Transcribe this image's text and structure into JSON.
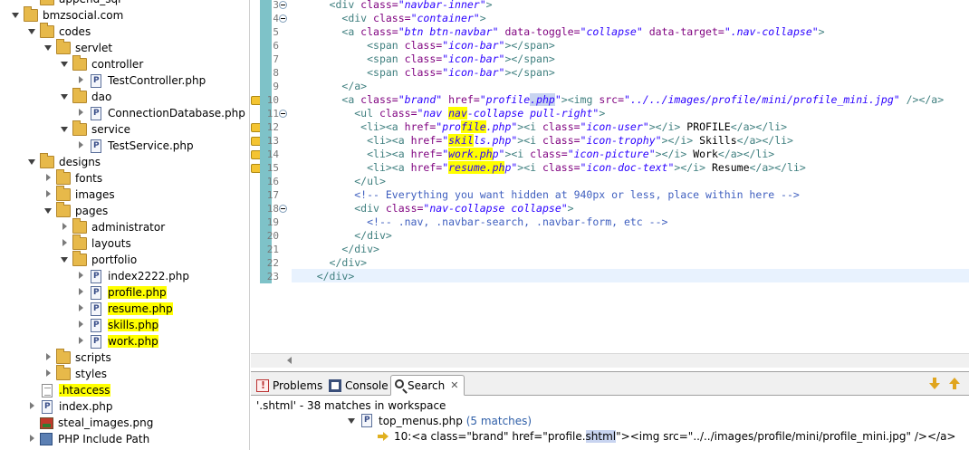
{
  "project_tree": {
    "items": [
      {
        "label": "append_sql",
        "level": 2,
        "icon": "folder-icon",
        "twisty": "none",
        "highlight": false
      },
      {
        "label": "bmzsocial.com",
        "level": 1,
        "icon": "folder-icon",
        "twisty": "open",
        "highlight": false
      },
      {
        "label": "codes",
        "level": 2,
        "icon": "folder-icon",
        "twisty": "open",
        "highlight": false
      },
      {
        "label": "servlet",
        "level": 3,
        "icon": "folder-icon",
        "twisty": "open",
        "highlight": false
      },
      {
        "label": "controller",
        "level": 4,
        "icon": "folder-icon",
        "twisty": "open",
        "highlight": false
      },
      {
        "label": "TestController.php",
        "level": 5,
        "icon": "php-file-icon",
        "twisty": "closed",
        "highlight": false
      },
      {
        "label": "dao",
        "level": 4,
        "icon": "folder-icon",
        "twisty": "open",
        "highlight": false
      },
      {
        "label": "ConnectionDatabase.php",
        "level": 5,
        "icon": "php-file-icon",
        "twisty": "closed",
        "highlight": false
      },
      {
        "label": "service",
        "level": 4,
        "icon": "folder-icon",
        "twisty": "open",
        "highlight": false
      },
      {
        "label": "TestService.php",
        "level": 5,
        "icon": "php-file-icon",
        "twisty": "closed",
        "highlight": false
      },
      {
        "label": "designs",
        "level": 2,
        "icon": "folder-icon",
        "twisty": "open",
        "highlight": false
      },
      {
        "label": "fonts",
        "level": 3,
        "icon": "folder-icon",
        "twisty": "closed",
        "highlight": false
      },
      {
        "label": "images",
        "level": 3,
        "icon": "folder-icon",
        "twisty": "closed",
        "highlight": false
      },
      {
        "label": "pages",
        "level": 3,
        "icon": "folder-icon",
        "twisty": "open",
        "highlight": false
      },
      {
        "label": "administrator",
        "level": 4,
        "icon": "folder-icon",
        "twisty": "closed",
        "highlight": false
      },
      {
        "label": "layouts",
        "level": 4,
        "icon": "folder-icon",
        "twisty": "closed",
        "highlight": false
      },
      {
        "label": "portfolio",
        "level": 4,
        "icon": "folder-icon",
        "twisty": "open",
        "highlight": false
      },
      {
        "label": "index2222.php",
        "level": 5,
        "icon": "php-file-icon",
        "twisty": "closed",
        "highlight": false
      },
      {
        "label": "profile.php",
        "level": 5,
        "icon": "php-file-icon",
        "twisty": "closed",
        "highlight": true
      },
      {
        "label": "resume.php",
        "level": 5,
        "icon": "php-file-icon",
        "twisty": "closed",
        "highlight": true
      },
      {
        "label": "skills.php",
        "level": 5,
        "icon": "php-file-icon",
        "twisty": "closed",
        "highlight": true
      },
      {
        "label": "work.php",
        "level": 5,
        "icon": "php-file-icon",
        "twisty": "closed",
        "highlight": true
      },
      {
        "label": "scripts",
        "level": 3,
        "icon": "folder-icon",
        "twisty": "closed",
        "highlight": false
      },
      {
        "label": "styles",
        "level": 3,
        "icon": "folder-icon",
        "twisty": "closed",
        "highlight": false
      },
      {
        "label": ".htaccess",
        "level": 2,
        "icon": "text-file-icon",
        "twisty": "none",
        "highlight": true
      },
      {
        "label": "index.php",
        "level": 2,
        "icon": "php-file-icon",
        "twisty": "closed",
        "highlight": false
      },
      {
        "label": "steal_images.png",
        "level": 2,
        "icon": "image-file-icon",
        "twisty": "none",
        "highlight": false
      },
      {
        "label": "PHP Include Path",
        "level": 2,
        "icon": "include-path-icon",
        "twisty": "closed",
        "highlight": false
      }
    ]
  },
  "editor": {
    "lines": [
      {
        "n": "3",
        "fold": true,
        "marker": false
      },
      {
        "n": "4",
        "fold": true,
        "marker": false
      },
      {
        "n": "5",
        "fold": false,
        "marker": false
      },
      {
        "n": "6",
        "fold": false,
        "marker": false
      },
      {
        "n": "7",
        "fold": false,
        "marker": false
      },
      {
        "n": "8",
        "fold": false,
        "marker": false
      },
      {
        "n": "9",
        "fold": false,
        "marker": false
      },
      {
        "n": "10",
        "fold": false,
        "marker": true
      },
      {
        "n": "11",
        "fold": true,
        "marker": false
      },
      {
        "n": "12",
        "fold": false,
        "marker": true
      },
      {
        "n": "13",
        "fold": false,
        "marker": true
      },
      {
        "n": "14",
        "fold": false,
        "marker": true
      },
      {
        "n": "15",
        "fold": false,
        "marker": true
      },
      {
        "n": "16",
        "fold": false,
        "marker": false
      },
      {
        "n": "17",
        "fold": false,
        "marker": false
      },
      {
        "n": "18",
        "fold": true,
        "marker": false
      },
      {
        "n": "19",
        "fold": false,
        "marker": false
      },
      {
        "n": "20",
        "fold": false,
        "marker": false
      },
      {
        "n": "21",
        "fold": false,
        "marker": false
      },
      {
        "n": "22",
        "fold": false,
        "marker": false
      },
      {
        "n": "23",
        "fold": false,
        "marker": false
      }
    ],
    "code": [
      [
        {
          "c": "tx",
          "t": "      "
        },
        {
          "c": "tg",
          "t": "<div "
        },
        {
          "c": "at",
          "t": "class="
        },
        {
          "c": "vl",
          "t": "\"navbar-inner\""
        },
        {
          "c": "tg",
          "t": ">"
        }
      ],
      [
        {
          "c": "tx",
          "t": "        "
        },
        {
          "c": "tg",
          "t": "<div "
        },
        {
          "c": "at",
          "t": "class="
        },
        {
          "c": "vl",
          "t": "\"container\""
        },
        {
          "c": "tg",
          "t": ">"
        }
      ],
      [
        {
          "c": "tx",
          "t": "        "
        },
        {
          "c": "tg",
          "t": "<a "
        },
        {
          "c": "at",
          "t": "class="
        },
        {
          "c": "vl",
          "t": "\"btn btn-navbar\""
        },
        {
          "c": "tx",
          "t": " "
        },
        {
          "c": "at",
          "t": "data-toggle="
        },
        {
          "c": "vl",
          "t": "\"collapse\""
        },
        {
          "c": "tx",
          "t": " "
        },
        {
          "c": "at",
          "t": "data-target="
        },
        {
          "c": "vl",
          "t": "\".nav-collapse\""
        },
        {
          "c": "tg",
          "t": ">"
        }
      ],
      [
        {
          "c": "tx",
          "t": "            "
        },
        {
          "c": "tg",
          "t": "<span "
        },
        {
          "c": "at",
          "t": "class="
        },
        {
          "c": "vl",
          "t": "\"icon-bar\""
        },
        {
          "c": "tg",
          "t": "></span>"
        }
      ],
      [
        {
          "c": "tx",
          "t": "            "
        },
        {
          "c": "tg",
          "t": "<span "
        },
        {
          "c": "at",
          "t": "class="
        },
        {
          "c": "vl",
          "t": "\"icon-bar\""
        },
        {
          "c": "tg",
          "t": "></span>"
        }
      ],
      [
        {
          "c": "tx",
          "t": "            "
        },
        {
          "c": "tg",
          "t": "<span "
        },
        {
          "c": "at",
          "t": "class="
        },
        {
          "c": "vl",
          "t": "\"icon-bar\""
        },
        {
          "c": "tg",
          "t": "></span>"
        }
      ],
      [
        {
          "c": "tx",
          "t": "        "
        },
        {
          "c": "tg",
          "t": "</a>"
        }
      ],
      [
        {
          "c": "tx",
          "t": "        "
        },
        {
          "c": "tg",
          "t": "<a "
        },
        {
          "c": "at",
          "t": "class="
        },
        {
          "c": "vl",
          "t": "\"brand\""
        },
        {
          "c": "tx",
          "t": " "
        },
        {
          "c": "at",
          "t": "href="
        },
        {
          "c": "vl",
          "t": "\"profile"
        },
        {
          "c": "vl sel",
          "t": ".php"
        },
        {
          "c": "vl",
          "t": "\""
        },
        {
          "c": "tg",
          "t": "><img "
        },
        {
          "c": "at",
          "t": "src="
        },
        {
          "c": "vl",
          "t": "\"../../images/profile/mini/profile_mini.jpg\""
        },
        {
          "c": "tx",
          "t": " "
        },
        {
          "c": "tg",
          "t": "/></a>"
        }
      ],
      [
        {
          "c": "tx",
          "t": "          "
        },
        {
          "c": "tg",
          "t": "<ul "
        },
        {
          "c": "at",
          "t": "class="
        },
        {
          "c": "vl",
          "t": "\"nav "
        },
        {
          "c": "vl yl",
          "t": "nav"
        },
        {
          "c": "vl",
          "t": "-collapse pull-right\""
        },
        {
          "c": "tg",
          "t": ">"
        }
      ],
      [
        {
          "c": "tx",
          "t": "           "
        },
        {
          "c": "tg",
          "t": "<li><a "
        },
        {
          "c": "at",
          "t": "href="
        },
        {
          "c": "vl",
          "t": "\"pro"
        },
        {
          "c": "vl yl",
          "t": "file"
        },
        {
          "c": "vl",
          "t": ".php\""
        },
        {
          "c": "tg",
          "t": "><i "
        },
        {
          "c": "at",
          "t": "class="
        },
        {
          "c": "vl",
          "t": "\"icon-user\""
        },
        {
          "c": "tg",
          "t": "></i>"
        },
        {
          "c": "tx",
          "t": " PROFILE"
        },
        {
          "c": "tg",
          "t": "</a></li>"
        }
      ],
      [
        {
          "c": "tx",
          "t": "            "
        },
        {
          "c": "tg",
          "t": "<li><a "
        },
        {
          "c": "at",
          "t": "href="
        },
        {
          "c": "vl",
          "t": "\""
        },
        {
          "c": "vl yl",
          "t": "skil"
        },
        {
          "c": "vl",
          "t": "ls.php\""
        },
        {
          "c": "tg",
          "t": "><i "
        },
        {
          "c": "at",
          "t": "class="
        },
        {
          "c": "vl",
          "t": "\"icon-trophy\""
        },
        {
          "c": "tg",
          "t": "></i>"
        },
        {
          "c": "tx",
          "t": " Skills"
        },
        {
          "c": "tg",
          "t": "</a></li>"
        }
      ],
      [
        {
          "c": "tx",
          "t": "            "
        },
        {
          "c": "tg",
          "t": "<li><a "
        },
        {
          "c": "at",
          "t": "href="
        },
        {
          "c": "vl",
          "t": "\""
        },
        {
          "c": "vl yl",
          "t": "work.ph"
        },
        {
          "c": "vl",
          "t": "p\""
        },
        {
          "c": "tg",
          "t": "><i "
        },
        {
          "c": "at",
          "t": "class="
        },
        {
          "c": "vl",
          "t": "\"icon-picture\""
        },
        {
          "c": "tg",
          "t": "></i>"
        },
        {
          "c": "tx",
          "t": " Work"
        },
        {
          "c": "tg",
          "t": "</a></li>"
        }
      ],
      [
        {
          "c": "tx",
          "t": "            "
        },
        {
          "c": "tg",
          "t": "<li><a "
        },
        {
          "c": "at",
          "t": "href="
        },
        {
          "c": "vl",
          "t": "\""
        },
        {
          "c": "vl yl",
          "t": "resume.ph"
        },
        {
          "c": "vl",
          "t": "p\""
        },
        {
          "c": "tg",
          "t": "><i "
        },
        {
          "c": "at",
          "t": "class="
        },
        {
          "c": "vl",
          "t": "\"icon-doc-text\""
        },
        {
          "c": "tg",
          "t": "></i>"
        },
        {
          "c": "tx",
          "t": " Resume"
        },
        {
          "c": "tg",
          "t": "</a></li>"
        }
      ],
      [
        {
          "c": "tx",
          "t": "          "
        },
        {
          "c": "tg",
          "t": "</ul>"
        }
      ],
      [
        {
          "c": "tx",
          "t": "          "
        },
        {
          "c": "cm",
          "t": "<!-- Everything you want hidden at 940px or less, place within here -->"
        }
      ],
      [
        {
          "c": "tx",
          "t": "          "
        },
        {
          "c": "tg",
          "t": "<div "
        },
        {
          "c": "at",
          "t": "class="
        },
        {
          "c": "vl",
          "t": "\"nav-collapse collapse\""
        },
        {
          "c": "tg",
          "t": ">"
        }
      ],
      [
        {
          "c": "tx",
          "t": "            "
        },
        {
          "c": "cm",
          "t": "<!-- .nav, .navbar-search, .navbar-form, etc -->"
        }
      ],
      [
        {
          "c": "tx",
          "t": "          "
        },
        {
          "c": "tg",
          "t": "</div>"
        }
      ],
      [
        {
          "c": "tx",
          "t": "        "
        },
        {
          "c": "tg",
          "t": "</div>"
        }
      ],
      [
        {
          "c": "tx",
          "t": "      "
        },
        {
          "c": "tg",
          "t": "</div>"
        }
      ],
      [
        {
          "c": "tx",
          "t": "    "
        },
        {
          "c": "tg",
          "t": "</div>"
        }
      ]
    ]
  },
  "panel": {
    "tabs": [
      {
        "label": "Problems",
        "icon": "problems-icon",
        "active": false
      },
      {
        "label": "Console",
        "icon": "console-icon",
        "active": false
      },
      {
        "label": "Search",
        "icon": "search-icon",
        "active": true
      }
    ],
    "tab_close": "✕",
    "summary": "'.shtml' - 38 matches in workspace",
    "result_file": "top_menus.php",
    "result_count": "(5 matches)",
    "result_line_num": "10:",
    "result_line_pre": " <a class=\"brand\" href=\"profile.",
    "result_line_match": "shtml",
    "result_line_post": "\"><img src=\"../../images/profile/mini/profile_mini.jpg\" /></a>"
  },
  "colors": {
    "highlight": "#ffff00",
    "line_number_bar": "#7ec2c8",
    "tag": "#3f7f7f",
    "attribute": "#7f007f",
    "value": "#2a00ff",
    "comment": "#3f5fbf"
  }
}
